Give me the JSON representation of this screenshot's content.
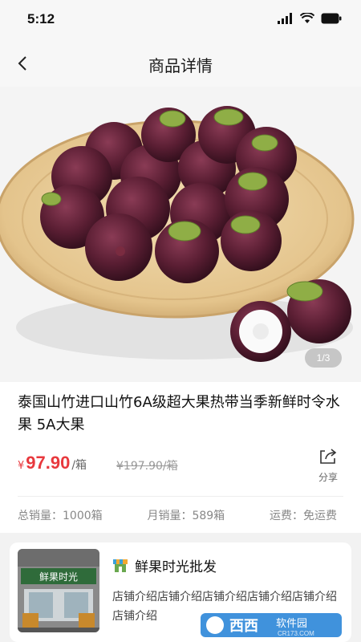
{
  "status_bar": {
    "time": "5:12"
  },
  "header": {
    "title": "商品详情"
  },
  "gallery": {
    "indicator": "1/3"
  },
  "product": {
    "title": "泰国山竹进口山竹6A级超大果热带当季新鲜时令水果 5A大果",
    "price_currency": "¥",
    "price": "97.90",
    "price_unit": "/箱",
    "original_price": "¥197.90/箱",
    "share_label": "分享"
  },
  "stats": {
    "total_sales": "总销量：1000箱",
    "monthly_sales": "月销量：589箱",
    "shipping": "运费：免运费"
  },
  "shop": {
    "name": "鲜果时光批发",
    "sign_text": "鲜果时光",
    "description": "店铺介绍店铺介绍店铺介绍店铺介绍店铺介绍店铺介绍"
  },
  "watermark": {
    "brand": "西西",
    "sub": "软件园",
    "url": "CR173.COM"
  },
  "colors": {
    "price": "#e8383d",
    "background": "#f2f2f2",
    "card": "#ffffff"
  }
}
